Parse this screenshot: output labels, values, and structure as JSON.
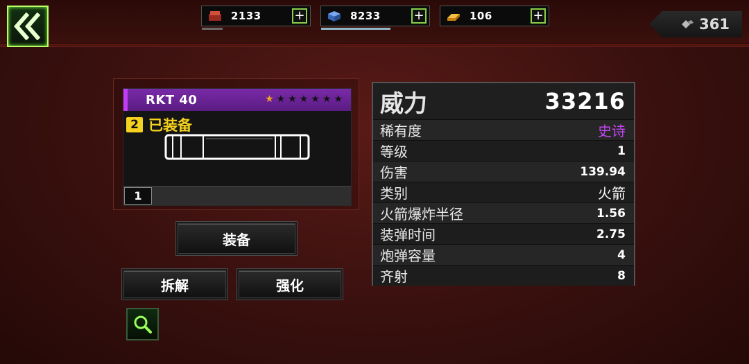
{
  "resources": [
    {
      "icon": "ammo-crate-icon",
      "value": "2133",
      "color": "#c0392b"
    },
    {
      "icon": "blue-cube-icon",
      "value": "8233",
      "color": "#4a78c8"
    },
    {
      "icon": "gold-bar-icon",
      "value": "106",
      "color": "#e8a020"
    }
  ],
  "gems": {
    "icon": "gem-icon",
    "value": "361"
  },
  "item": {
    "name": "RKT 40",
    "stars_total": 7,
    "stars_filled": 1,
    "slot": "2",
    "equipped_label": "已装备",
    "level": "1"
  },
  "buttons": {
    "equip": "装备",
    "dismantle": "拆解",
    "upgrade": "强化"
  },
  "stats": {
    "power_label": "威力",
    "power_value": "33216",
    "rows": [
      {
        "label": "稀有度",
        "value": "史诗"
      },
      {
        "label": "等级",
        "value": "1"
      },
      {
        "label": "伤害",
        "value": "139.94"
      },
      {
        "label": "类别",
        "value": "火箭"
      },
      {
        "label": "火箭爆炸半径",
        "value": "1.56"
      },
      {
        "label": "装弹时间",
        "value": "2.75"
      },
      {
        "label": "炮弹容量",
        "value": "4"
      },
      {
        "label": "齐射",
        "value": "8"
      }
    ]
  },
  "colors": {
    "accent_green": "#b8ff6a",
    "epic_purple": "#c546f2",
    "equipped_yellow": "#f5d21e"
  }
}
